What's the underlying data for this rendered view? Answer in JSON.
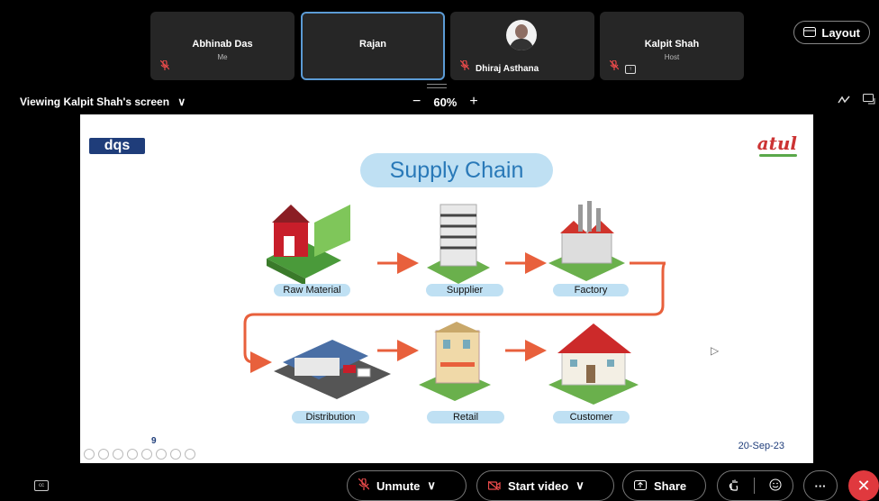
{
  "participants": [
    {
      "name": "Abhinab Das",
      "sub": "Me"
    },
    {
      "name": "Rajan"
    },
    {
      "name": "Dhiraj Asthana"
    },
    {
      "name": "Kalpit Shah",
      "sub": "Host"
    }
  ],
  "icons": {
    "mic_muted": "mic-off-icon",
    "layout": "layout-icon",
    "share": "screen-share-icon"
  },
  "layout_label": "Layout",
  "viewing": {
    "label": "Viewing Kalpit Shah's screen",
    "chevron": "∨"
  },
  "zoom": {
    "minus": "−",
    "value": "60%",
    "plus": "+"
  },
  "slide": {
    "logo_left": "dqs",
    "logo_right": "atul",
    "title": "Supply Chain",
    "stages": [
      "Raw Material",
      "Supplier",
      "Factory",
      "Distribution",
      "Retail",
      "Customer"
    ],
    "page": "9",
    "date": "20-Sep-23"
  },
  "controls": {
    "unmute": "Unmute",
    "start_video": "Start video",
    "share": "Share",
    "more": "···",
    "end": "✕"
  },
  "colors": {
    "accent": "#5b9bd5",
    "muted": "#e84a4a",
    "end": "#e0393e",
    "arrow": "#e8603c",
    "label_bg": "#bfe0f3"
  }
}
